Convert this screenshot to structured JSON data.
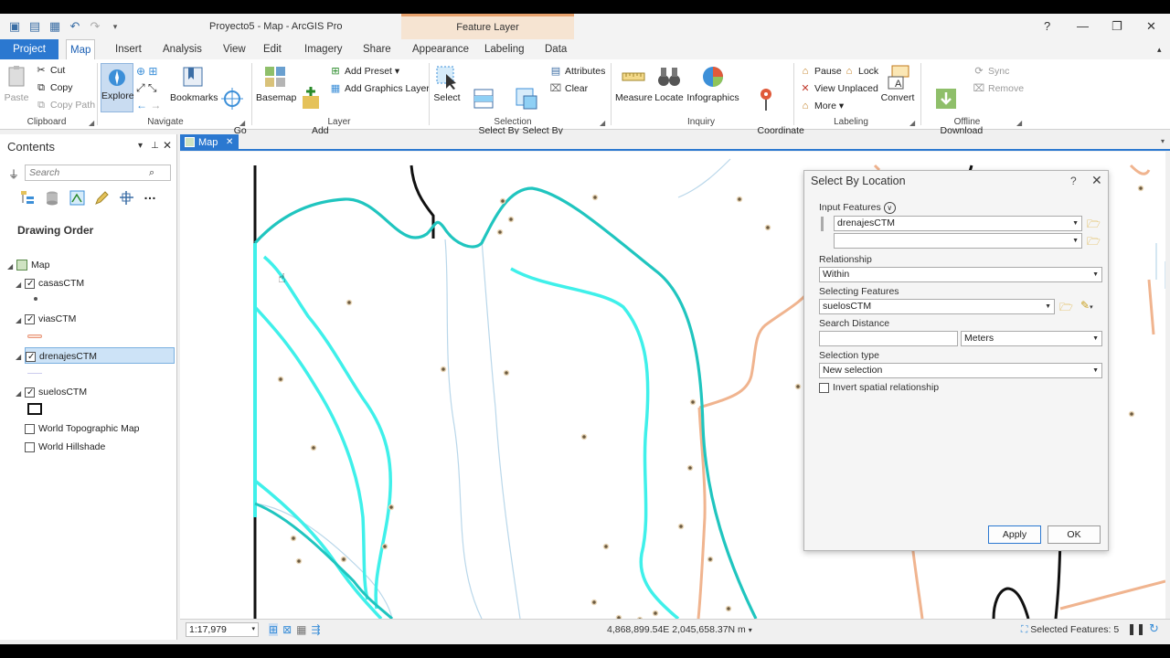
{
  "titlebar": {
    "title": "Proyecto5 - Map - ArcGIS Pro",
    "context_tab": "Feature Layer",
    "help": "?",
    "minimize": "—",
    "restore": "❐",
    "close": "✕"
  },
  "tabs": [
    "Project",
    "Map",
    "Insert",
    "Analysis",
    "View",
    "Edit",
    "Imagery",
    "Share",
    "Appearance",
    "Labeling",
    "Data"
  ],
  "ribbon": {
    "clipboard": {
      "label": "Clipboard",
      "paste": "Paste",
      "cut": "Cut",
      "copy": "Copy",
      "copy_path": "Copy Path"
    },
    "navigate": {
      "label": "Navigate",
      "explore": "Explore",
      "bookmarks": "Bookmarks",
      "go_to_xy": "Go\nTo XY"
    },
    "layer": {
      "label": "Layer",
      "basemap": "Basemap",
      "add_data": "Add\nData",
      "add_preset": "Add Preset",
      "add_graphics_layer": "Add Graphics Layer"
    },
    "selection": {
      "label": "Selection",
      "select": "Select",
      "select_by_attributes": "Select By\nAttributes",
      "select_by_location": "Select By\nLocation",
      "attributes": "Attributes",
      "clear": "Clear"
    },
    "inquiry": {
      "label": "Inquiry",
      "measure": "Measure",
      "locate": "Locate",
      "infographics": "Infographics",
      "coordinate_conversion": "Coordinate\nConversion"
    },
    "labeling": {
      "label": "Labeling",
      "pause": "Pause",
      "lock": "Lock",
      "view_unplaced": "View Unplaced",
      "more": "More",
      "convert": "Convert"
    },
    "offline": {
      "label": "Offline",
      "download_map": "Download\nMap",
      "sync": "Sync",
      "remove": "Remove"
    }
  },
  "contents": {
    "title": "Contents",
    "search_placeholder": "Search",
    "drawing_order": "Drawing Order",
    "map_label": "Map",
    "layers": [
      {
        "name": "casasCTM",
        "checked": true
      },
      {
        "name": "viasCTM",
        "checked": true
      },
      {
        "name": "drenajesCTM",
        "checked": true,
        "selected": true
      },
      {
        "name": "suelosCTM",
        "checked": true
      },
      {
        "name": "World Topographic Map",
        "checked": false
      },
      {
        "name": "World Hillshade",
        "checked": false
      }
    ]
  },
  "map_view": {
    "tab_label": "Map",
    "scale": "1:17,979",
    "coordinates": "4,868,899.54E 2,045,658.37N m",
    "selected_features": "Selected Features: 5"
  },
  "dialog": {
    "title": "Select By Location",
    "help": "?",
    "input_features_label": "Input Features",
    "input_features_value": "drenajesCTM",
    "input_features_value2": "",
    "relationship_label": "Relationship",
    "relationship_value": "Within",
    "selecting_features_label": "Selecting Features",
    "selecting_features_value": "suelosCTM",
    "search_distance_label": "Search Distance",
    "search_distance_value": "",
    "search_distance_unit": "Meters",
    "selection_type_label": "Selection type",
    "selection_type_value": "New selection",
    "invert_label": "Invert spatial relationship",
    "invert_checked": false,
    "apply": "Apply",
    "ok": "OK"
  },
  "colors": {
    "accent": "#2b78d0",
    "drainage": "#1ec9c0",
    "drainage_selected": "#3ff0ea",
    "roads": "#f0b48f",
    "context_tab": "#f6e4d2"
  }
}
